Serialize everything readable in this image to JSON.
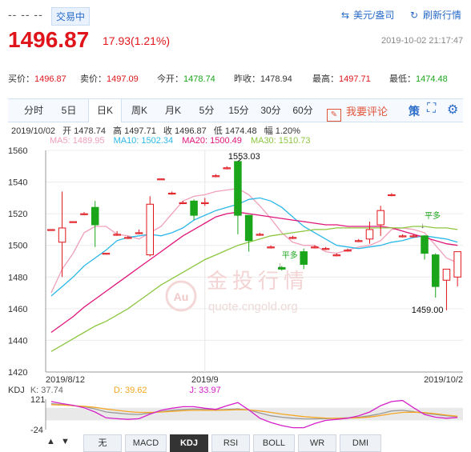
{
  "header": {
    "placeholder_code": "-- -- --",
    "status_badge": "交易中",
    "currency_link": "美元/盎司",
    "refresh_link": "刷新行情",
    "price": "1496.87",
    "change": "17.93(1.21%)",
    "datetime": "2019-10-02 21:17:47"
  },
  "quotes": [
    {
      "label": "买价：",
      "value": "1496.87",
      "color": "red"
    },
    {
      "label": "卖价：",
      "value": "1497.09",
      "color": "red"
    },
    {
      "label": "今开：",
      "value": "1478.74",
      "color": "green"
    },
    {
      "label": "昨收：",
      "value": "1478.94",
      "color": "normal"
    },
    {
      "label": "最高：",
      "value": "1497.71",
      "color": "red"
    },
    {
      "label": "最低：",
      "value": "1474.48",
      "color": "green"
    }
  ],
  "tabs": [
    "分时",
    "5日",
    "日K",
    "周K",
    "月K",
    "5分",
    "15分",
    "30分",
    "60分"
  ],
  "active_tab": "日K",
  "comment_button": "我要评论",
  "strategy_label": "策",
  "info_line": {
    "date": "2019/10/02",
    "open": "开 1478.74",
    "high": "高 1497.71",
    "close": "收 1496.87",
    "low": "低 1474.48",
    "amp": "幅 1.20%"
  },
  "ma_legend": [
    {
      "label": "MA5: 1489.95",
      "color": "#f0a0b8"
    },
    {
      "label": "MA10: 1502.34",
      "color": "#2cb8e8"
    },
    {
      "label": "MA20: 1500.49",
      "color": "#e0157a"
    },
    {
      "label": "MA30: 1510.73",
      "color": "#8cc63f"
    }
  ],
  "watermark": {
    "brand": "金投行情",
    "url": "quote.cngold.org",
    "logo": "Au"
  },
  "kdj_legend": {
    "name": "KDJ",
    "k": "K: 37.74",
    "d": "D: 39.62",
    "j": "J: 33.97"
  },
  "bottom_tabs": [
    "无",
    "MACD",
    "KDJ",
    "RSI",
    "BOLL",
    "WR",
    "DMI"
  ],
  "active_bottom_tab": "KDJ",
  "chart_data": {
    "type": "candlestick",
    "y_ticks": [
      1560,
      1540,
      1520,
      1500,
      1480,
      1460,
      1440,
      1420
    ],
    "ylim": [
      1420,
      1560
    ],
    "x_labels": [
      {
        "index": 0,
        "text": "2019/8/12"
      },
      {
        "index": 14,
        "text": "2019/9"
      },
      {
        "index": 36,
        "text": "2019/10/2"
      }
    ],
    "annotations": [
      {
        "index": 17,
        "value": 1553.03,
        "text": "1553.03",
        "kind": "max"
      },
      {
        "index": 35,
        "value": 1459.0,
        "text": "1459.00",
        "kind": "min"
      },
      {
        "index": 21,
        "value": 1487,
        "text": "平多",
        "kind": "signal"
      },
      {
        "index": 34,
        "value": 1512,
        "text": "平多",
        "kind": "signal"
      }
    ],
    "candles": [
      {
        "o": 1510,
        "h": 1510,
        "l": 1510,
        "c": 1510
      },
      {
        "o": 1502,
        "h": 1534,
        "l": 1480,
        "c": 1511
      },
      {
        "o": 1515,
        "h": 1515,
        "l": 1515,
        "c": 1515
      },
      {
        "o": 1520,
        "h": 1521,
        "l": 1519,
        "c": 1520
      },
      {
        "o": 1524,
        "h": 1528,
        "l": 1499,
        "c": 1513
      },
      {
        "o": 1495,
        "h": 1495,
        "l": 1495,
        "c": 1495
      },
      {
        "o": 1507,
        "h": 1509,
        "l": 1506,
        "c": 1507
      },
      {
        "o": 1505,
        "h": 1506,
        "l": 1504,
        "c": 1505
      },
      {
        "o": 1508,
        "h": 1510,
        "l": 1507,
        "c": 1508
      },
      {
        "o": 1494,
        "h": 1531,
        "l": 1493,
        "c": 1526
      },
      {
        "o": 1542,
        "h": 1542,
        "l": 1542,
        "c": 1542
      },
      {
        "o": 1533,
        "h": 1534,
        "l": 1532,
        "c": 1533
      },
      {
        "o": 1527,
        "h": 1528,
        "l": 1526,
        "c": 1527
      },
      {
        "o": 1528,
        "h": 1529,
        "l": 1516,
        "c": 1519
      },
      {
        "o": 1527,
        "h": 1530,
        "l": 1525,
        "c": 1527
      },
      {
        "o": 1544,
        "h": 1545,
        "l": 1543,
        "c": 1544
      },
      {
        "o": 1549,
        "h": 1550,
        "l": 1548,
        "c": 1549
      },
      {
        "o": 1553,
        "h": 1553,
        "l": 1507,
        "c": 1519
      },
      {
        "o": 1519,
        "h": 1519,
        "l": 1496,
        "c": 1503
      },
      {
        "o": 1507,
        "h": 1508,
        "l": 1506,
        "c": 1507
      },
      {
        "o": 1499,
        "h": 1500,
        "l": 1498,
        "c": 1499
      },
      {
        "o": 1486,
        "h": 1487,
        "l": 1484,
        "c": 1485
      },
      {
        "o": 1505,
        "h": 1506,
        "l": 1504,
        "c": 1505
      },
      {
        "o": 1496,
        "h": 1498,
        "l": 1485,
        "c": 1488
      },
      {
        "o": 1499,
        "h": 1500,
        "l": 1498,
        "c": 1499
      },
      {
        "o": 1498,
        "h": 1499,
        "l": 1497,
        "c": 1498
      },
      {
        "o": 1494,
        "h": 1495,
        "l": 1493,
        "c": 1494
      },
      {
        "o": 1497,
        "h": 1498,
        "l": 1496,
        "c": 1497
      },
      {
        "o": 1503,
        "h": 1504,
        "l": 1502,
        "c": 1503
      },
      {
        "o": 1504,
        "h": 1515,
        "l": 1501,
        "c": 1510
      },
      {
        "o": 1513,
        "h": 1525,
        "l": 1506,
        "c": 1522
      },
      {
        "o": 1532,
        "h": 1533,
        "l": 1531,
        "c": 1532
      },
      {
        "o": 1506,
        "h": 1507,
        "l": 1505,
        "c": 1506
      },
      {
        "o": 1506,
        "h": 1507,
        "l": 1505,
        "c": 1506
      },
      {
        "o": 1506,
        "h": 1506,
        "l": 1491,
        "c": 1495
      },
      {
        "o": 1494,
        "h": 1495,
        "l": 1467,
        "c": 1474
      },
      {
        "o": 1478,
        "h": 1478,
        "l": 1459,
        "c": 1485
      },
      {
        "o": 1480,
        "h": 1496,
        "l": 1474,
        "c": 1496
      }
    ],
    "ma_series": [
      {
        "name": "MA5",
        "color": "#f0a0b8",
        "values": [
          1470,
          1485,
          1495,
          1508,
          1512,
          1512,
          1507,
          1506,
          1504,
          1508,
          1512,
          1520,
          1528,
          1531,
          1532,
          1534,
          1535,
          1536,
          1532,
          1525,
          1517,
          1508,
          1502,
          1500,
          1500,
          1496,
          1495,
          1497,
          1499,
          1500,
          1503,
          1510,
          1511,
          1510,
          1508,
          1500,
          1492,
          1489
        ]
      },
      {
        "name": "MA10",
        "color": "#2cb8e8",
        "values": [
          1468,
          1474,
          1480,
          1487,
          1492,
          1497,
          1503,
          1505,
          1506,
          1507,
          1506,
          1508,
          1511,
          1516,
          1519,
          1522,
          1524,
          1526,
          1529,
          1530,
          1528,
          1524,
          1518,
          1512,
          1508,
          1504,
          1500,
          1499,
          1498,
          1499,
          1500,
          1502,
          1503,
          1505,
          1506,
          1505,
          1504,
          1502
        ]
      },
      {
        "name": "MA20",
        "color": "#e0157a",
        "values": [
          1445,
          1450,
          1455,
          1461,
          1466,
          1471,
          1476,
          1481,
          1486,
          1491,
          1496,
          1501,
          1506,
          1510,
          1514,
          1518,
          1520,
          1521,
          1520,
          1519,
          1518,
          1517,
          1516,
          1515,
          1514,
          1513,
          1513,
          1512,
          1512,
          1512,
          1512,
          1511,
          1509,
          1507,
          1505,
          1503,
          1501,
          1500
        ]
      },
      {
        "name": "MA30",
        "color": "#8cc63f",
        "values": [
          1433,
          1437,
          1441,
          1445,
          1449,
          1452,
          1456,
          1460,
          1465,
          1470,
          1475,
          1479,
          1483,
          1487,
          1491,
          1494,
          1497,
          1500,
          1502,
          1504,
          1506,
          1507,
          1508,
          1509,
          1510,
          1510,
          1511,
          1511,
          1511,
          1511,
          1511,
          1511,
          1511,
          1512,
          1512,
          1511,
          1511,
          1510
        ]
      }
    ],
    "kdj": {
      "ylim": [
        -24,
        121
      ],
      "y_ticks": [
        121,
        -24
      ],
      "series": [
        {
          "name": "K",
          "color": "#999999",
          "values": [
            100,
            95,
            90,
            85,
            75,
            60,
            55,
            50,
            48,
            55,
            62,
            68,
            72,
            74,
            72,
            70,
            72,
            75,
            70,
            55,
            42,
            35,
            30,
            27,
            27,
            28,
            30,
            32,
            35,
            42,
            52,
            65,
            68,
            62,
            54,
            48,
            42,
            37.74
          ]
        },
        {
          "name": "D",
          "color": "#f5a623",
          "values": [
            95,
            93,
            90,
            87,
            82,
            74,
            68,
            62,
            58,
            58,
            60,
            63,
            66,
            68,
            68,
            68,
            69,
            71,
            70,
            65,
            58,
            50,
            44,
            38,
            34,
            31,
            30,
            31,
            32,
            36,
            43,
            52,
            58,
            59,
            57,
            52,
            45,
            39.62
          ]
        },
        {
          "name": "J",
          "color": "#d520c8",
          "values": [
            110,
            100,
            92,
            80,
            60,
            32,
            28,
            25,
            28,
            50,
            68,
            78,
            85,
            85,
            78,
            72,
            90,
            105,
            70,
            30,
            10,
            -5,
            -15,
            -15,
            5,
            20,
            25,
            30,
            42,
            60,
            90,
            110,
            115,
            80,
            48,
            35,
            30,
            33.97
          ]
        }
      ]
    }
  }
}
